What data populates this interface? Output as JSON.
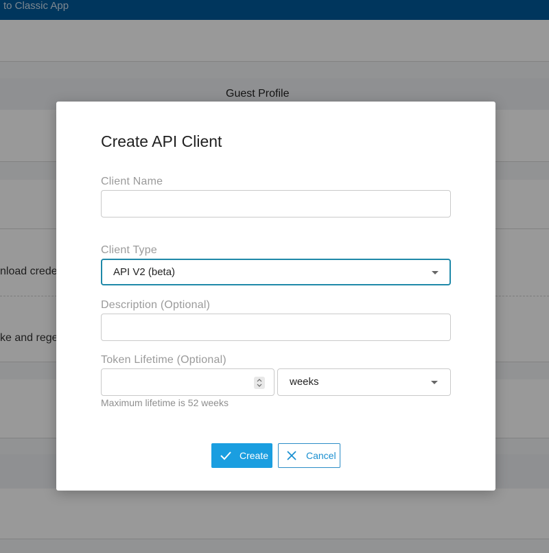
{
  "background": {
    "topbar_text": "to Classic App",
    "section_header": "Guest Profile",
    "row_text_1": "nload crede",
    "row_text_2": "ke and rege"
  },
  "modal": {
    "title": "Create API Client",
    "client_name": {
      "label": "Client Name",
      "value": ""
    },
    "client_type": {
      "label": "Client Type",
      "selected": "API V2 (beta)"
    },
    "description": {
      "label": "Description (Optional)",
      "value": ""
    },
    "token_lifetime": {
      "label": "Token Lifetime (Optional)",
      "value": "",
      "unit_selected": "weeks",
      "hint": "Maximum lifetime is 52 weeks"
    },
    "buttons": {
      "create": "Create",
      "cancel": "Cancel"
    }
  },
  "colors": {
    "topbar": "#005a9c",
    "primary": "#1a9ee0",
    "focus_border": "#1e88a8"
  },
  "icons": {
    "create": "check-icon",
    "cancel": "close-icon",
    "dropdown": "caret-down-icon",
    "spinner": "stepper-icon"
  }
}
